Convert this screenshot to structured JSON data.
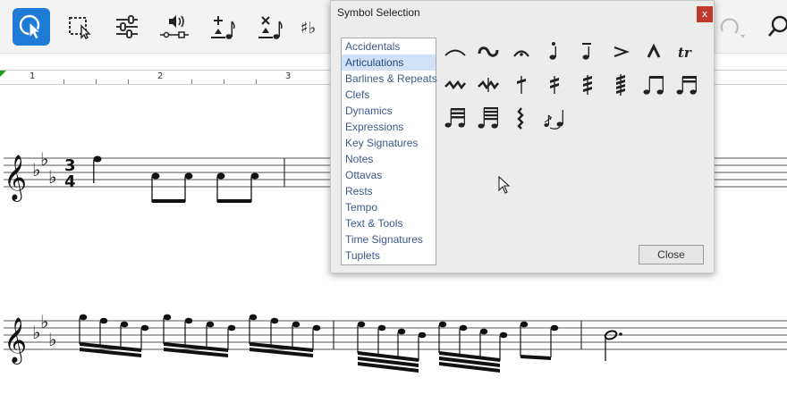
{
  "toolbar": {
    "tools": [
      {
        "name": "select-pointer",
        "active": true
      },
      {
        "name": "marquee-select",
        "active": false
      },
      {
        "name": "mixer-sliders",
        "active": false
      },
      {
        "name": "playback-speaker",
        "active": false
      },
      {
        "name": "add-note",
        "active": false
      },
      {
        "name": "delete-note",
        "active": false
      },
      {
        "name": "accidentals-partial",
        "active": false
      },
      {
        "name": "redo-arrow",
        "active": false
      },
      {
        "name": "search-magnifier",
        "active": false
      }
    ]
  },
  "ruler": {
    "labels": [
      "1",
      "2",
      "3"
    ]
  },
  "dialog": {
    "title": "Symbol Selection",
    "close_x": "x",
    "categories": [
      "Accidentals",
      "Articulations",
      "Barlines & Repeats",
      "Clefs",
      "Dynamics",
      "Expressions",
      "Key Signatures",
      "Notes",
      "Ottavas",
      "Rests",
      "Tempo",
      "Text & Tools",
      "Time Signatures",
      "Tuplets"
    ],
    "selected_category": "Articulations",
    "symbols": [
      "slur-icon",
      "turn-icon",
      "fermata-icon",
      "staccato-icon",
      "tenuto-staccato-icon",
      "accent-icon",
      "marcato-icon",
      "trill-icon",
      "mordent-icon",
      "inverted-mordent-icon",
      "tremolo-1-icon",
      "tremolo-2-icon",
      "tremolo-3-icon",
      "tremolo-4-icon",
      "beamed-eighths-icon",
      "beamed-sixteenths-icon",
      "beamed-32nds-icon",
      "beamed-64ths-icon",
      "arpeggio-icon",
      "grace-note-icon"
    ],
    "trill_label": "tr",
    "close_button": "Close"
  },
  "score": {
    "time_signature_top": "3",
    "time_signature_bottom": "4"
  }
}
